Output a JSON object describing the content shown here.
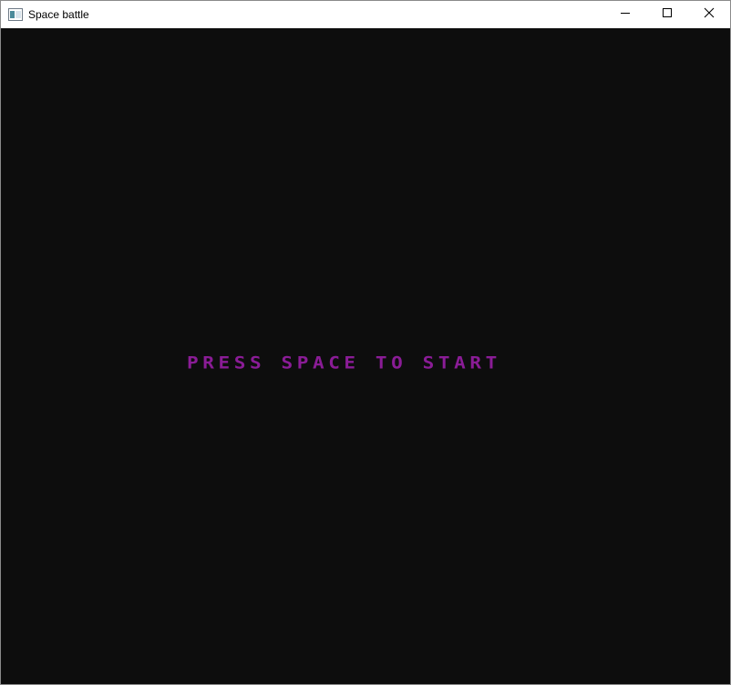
{
  "window": {
    "title": "Space battle",
    "app_icon": "window-app-icon",
    "controls": {
      "minimize_icon": "minimize-icon",
      "maximize_icon": "maximize-icon",
      "close_icon": "close-icon"
    }
  },
  "game": {
    "background_color": "#0d0d0d",
    "prompt_text": "PRESS SPACE TO START",
    "prompt_color": "#8a1c96"
  }
}
